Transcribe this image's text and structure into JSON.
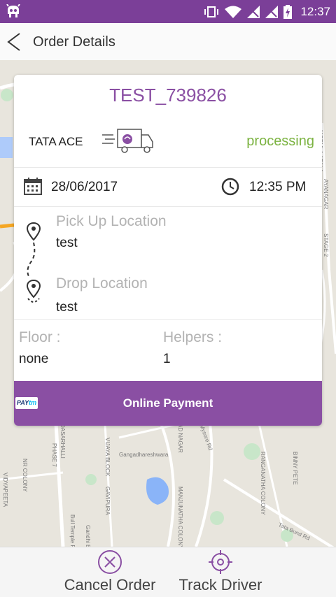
{
  "status_bar": {
    "time": "12:37"
  },
  "app_bar": {
    "title": "Order Details"
  },
  "map_labels": [
    "MODULA APALA",
    "STAGE 2",
    "AYANAGAR",
    "DASARHALLI",
    "PHASE 7",
    "VIJAYA BLOCK",
    "AD NAGAR",
    "Gangadhareshwara",
    "GAVIPURA",
    "MANJUNATHA COLONY",
    "Mysore Rd",
    "Tata Bund Rd",
    "BINNY PETE",
    "RANGANATHA COLONY",
    "NR COLONY",
    "VIDYAPEETA",
    "Bull Temple Rd",
    "Gandhi Bazaar"
  ],
  "order": {
    "id": "TEST_739826",
    "vehicle": "TATA ACE",
    "status": "processing",
    "date": "28/06/2017",
    "time": "12:35 PM",
    "pickup_label": "Pick Up Location",
    "pickup_value": "test",
    "drop_label": "Drop Location",
    "drop_value": "test",
    "floor_label": "Floor :",
    "floor_value": "none",
    "helpers_label": "Helpers :",
    "helpers_value": "1"
  },
  "payment": {
    "logo_text_pay": "PAY",
    "logo_text_tm": "tm",
    "label": "Online Payment"
  },
  "actions": {
    "cancel": "Cancel Order",
    "track": "Track Driver"
  },
  "colors": {
    "brand": "#7b3f98",
    "accent": "#8a4fa3",
    "status": "#7cb342"
  }
}
